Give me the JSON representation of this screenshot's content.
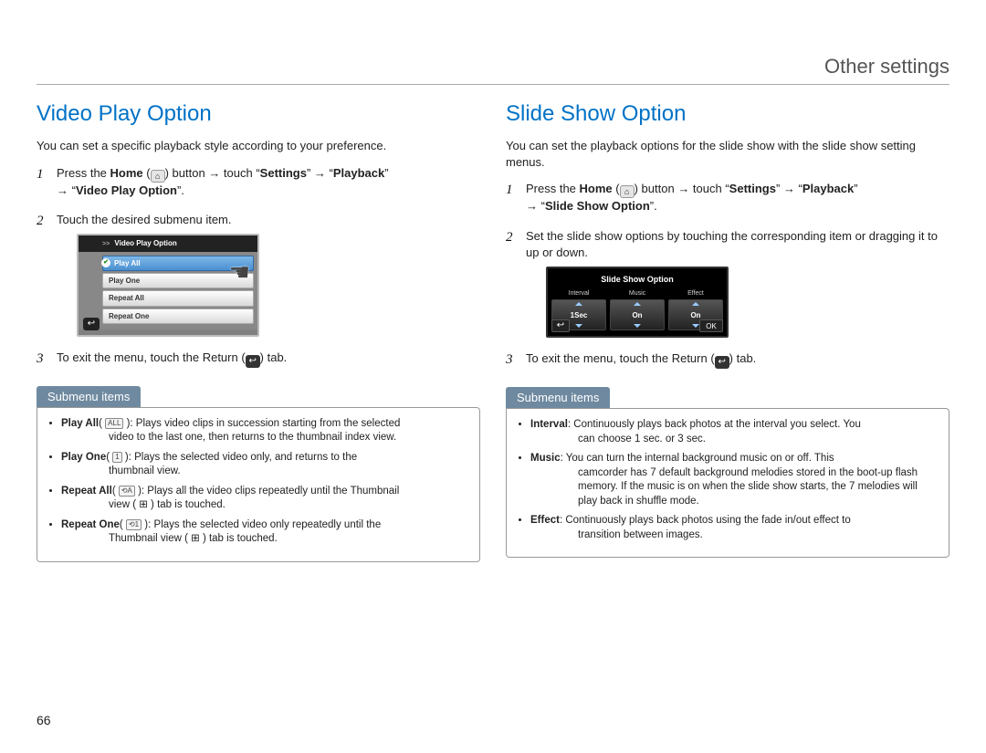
{
  "header": {
    "title": "Other settings"
  },
  "page_number": "66",
  "left": {
    "title": "Video Play Option",
    "intro": "You can set a specific playback style according to your preference.",
    "steps": {
      "s1a": "Press the ",
      "s1_home": "Home",
      "s1b": " (",
      "s1c": ") button ",
      "s1d": " touch “",
      "s1_settings": "Settings",
      "s1e": "” ",
      "s1f": " “",
      "s1_playback": "Playback",
      "s1g": "” ",
      "s1h": " “",
      "s1_option": "Video Play Option",
      "s1i": "”.",
      "s2": "Touch the desired submenu item.",
      "s3a": "To exit the menu, touch the Return (",
      "s3b": ") tab."
    },
    "mini": {
      "crumb": ">>",
      "title": "Video Play Option",
      "items": [
        "Play All",
        "Play One",
        "Repeat All",
        "Repeat One"
      ]
    },
    "submenu_label": "Submenu items",
    "submenu": [
      {
        "name": "Play All",
        "icon": "ALL",
        "text": ": Plays video clips in succession starting from the selected",
        "cont": "video to the last one, then returns to the thumbnail index view."
      },
      {
        "name": "Play One",
        "icon": "1",
        "text": ": Plays the selected video only, and returns to the",
        "cont": "thumbnail view."
      },
      {
        "name": "Repeat All",
        "icon": "⟲A",
        "text": ": Plays all the video clips repeatedly until the Thumbnail",
        "cont": "view ( ⊞ ) tab is touched."
      },
      {
        "name": "Repeat One",
        "icon": "⟲1",
        "text": ": Plays the selected video only repeatedly until the",
        "cont": "Thumbnail view ( ⊞ ) tab is touched."
      }
    ]
  },
  "right": {
    "title": "Slide Show Option",
    "intro": "You can set the playback options for the slide show with the slide show setting menus.",
    "steps": {
      "s1a": "Press the ",
      "s1_home": "Home",
      "s1b": " (",
      "s1c": ") button ",
      "s1d": " touch “",
      "s1_settings": "Settings",
      "s1e": "” ",
      "s1f": " “",
      "s1_playback": "Playback",
      "s1g": "” ",
      "s1h": " “",
      "s1_option": "Slide Show Option",
      "s1i": "”.",
      "s2": "Set the slide show options by touching the corresponding item or dragging it to up or down.",
      "s3a": "To exit the menu, touch the Return (",
      "s3b": ") tab."
    },
    "mini": {
      "title": "Slide Show Option",
      "cols": [
        {
          "label": "Interval",
          "value": "1Sec"
        },
        {
          "label": "Music",
          "value": "On"
        },
        {
          "label": "Effect",
          "value": "On"
        }
      ],
      "ok": "OK"
    },
    "submenu_label": "Submenu items",
    "submenu": [
      {
        "name": "Interval",
        "text": ": Continuously plays back photos at the interval you select. You",
        "cont": "can choose 1 sec. or 3 sec."
      },
      {
        "name": "Music",
        "text": ": You can turn the internal background music on or off. This",
        "cont": "camcorder has 7 default background melodies stored in the boot-up flash memory. If the music is on when the slide show starts, the 7 melodies will play back in shuffle mode."
      },
      {
        "name": "Effect",
        "text": ": Continuously plays back photos using the fade in/out effect to",
        "cont": "transition between images."
      }
    ]
  }
}
